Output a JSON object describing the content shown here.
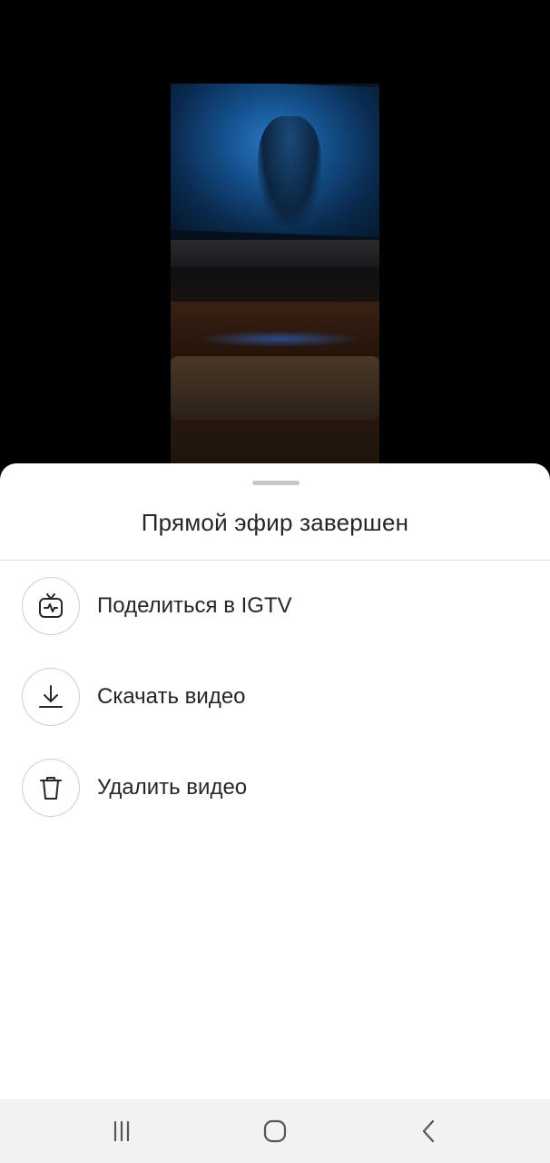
{
  "sheet": {
    "title": "Прямой эфир завершен",
    "items": [
      {
        "label": "Поделиться в IGTV",
        "icon": "igtv-icon"
      },
      {
        "label": "Скачать видео",
        "icon": "download-icon"
      },
      {
        "label": "Удалить видео",
        "icon": "trash-icon"
      }
    ]
  },
  "navbar": {
    "buttons": [
      "recents-icon",
      "home-icon",
      "back-icon"
    ]
  },
  "colors": {
    "text": "#262626",
    "divider": "#dbdbdb",
    "icon_border": "#cfcfcf",
    "navbar_bg": "#f2f2f2"
  }
}
